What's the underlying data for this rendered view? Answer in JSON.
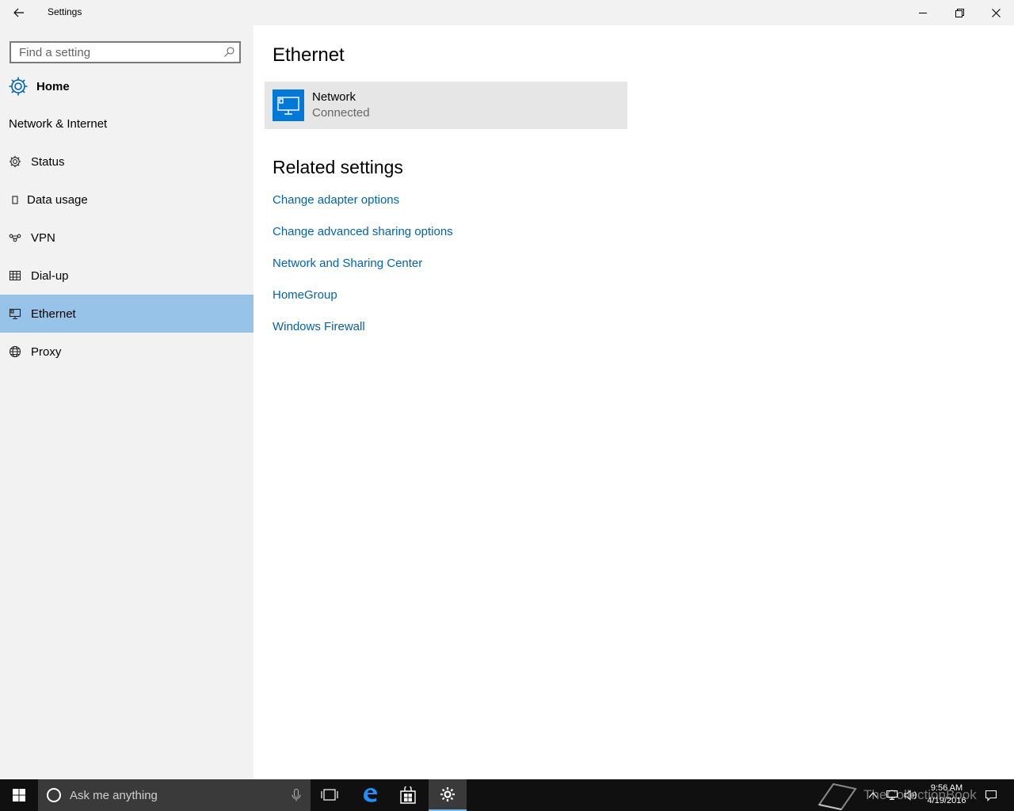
{
  "titlebar": {
    "title": "Settings",
    "back_icon": "back-arrow-icon",
    "minimize_icon": "minimize-icon",
    "maximize_icon": "restore-icon",
    "close_icon": "close-icon"
  },
  "sidebar": {
    "search": {
      "placeholder": "Find a setting",
      "value": "",
      "icon": "search-icon"
    },
    "home": {
      "label": "Home",
      "icon": "gear-icon"
    },
    "section_title": "Network & Internet",
    "items": [
      {
        "label": "Status",
        "icon": "gear-icon",
        "selected": false
      },
      {
        "label": "Data usage",
        "icon": "data-usage-icon",
        "selected": false
      },
      {
        "label": "VPN",
        "icon": "vpn-icon",
        "selected": false
      },
      {
        "label": "Dial-up",
        "icon": "dial-up-icon",
        "selected": false
      },
      {
        "label": "Ethernet",
        "icon": "ethernet-icon",
        "selected": true
      },
      {
        "label": "Proxy",
        "icon": "globe-icon",
        "selected": false
      }
    ]
  },
  "main": {
    "heading": "Ethernet",
    "network": {
      "name": "Network",
      "status": "Connected",
      "icon": "ethernet-monitor-icon"
    },
    "related_heading": "Related settings",
    "links": [
      "Change adapter options",
      "Change advanced sharing options",
      "Network and Sharing Center",
      "HomeGroup",
      "Windows Firewall"
    ]
  },
  "taskbar": {
    "search_placeholder": "Ask me anything",
    "clock_time": "9:56 AM",
    "clock_date": "4/19/2016",
    "watermark": "TheCollectionBook",
    "apps": [
      "task-view-icon",
      "edge-icon",
      "store-icon",
      "settings-icon"
    ]
  },
  "colors": {
    "accent": "#0078d7",
    "selected_bg": "#97c3e8",
    "link": "#0063b1",
    "sidebar_bg": "#f2f2f2",
    "taskbar_bg": "#101010"
  }
}
